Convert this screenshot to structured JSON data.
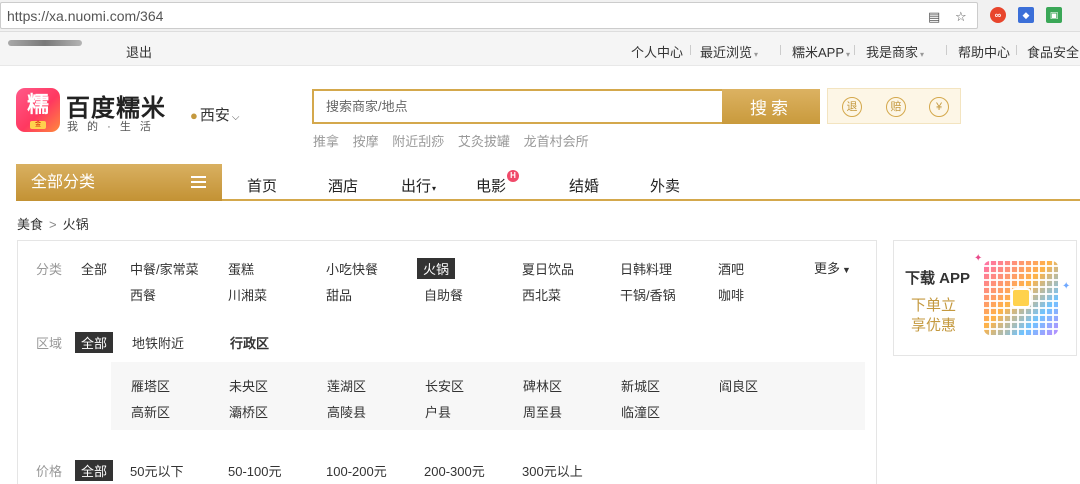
{
  "browser": {
    "url": "https://xa.nuomi.com/364",
    "icons": [
      "translate-icon",
      "star-icon",
      "extension-icons"
    ]
  },
  "top_bar": {
    "logout": "退出",
    "links": [
      {
        "label": "个人中心",
        "has_caret": false
      },
      {
        "label": "最近浏览",
        "has_caret": true
      },
      {
        "label": "糯米APP",
        "has_caret": true
      },
      {
        "label": "我是商家",
        "has_caret": true
      },
      {
        "label": "帮助中心",
        "has_caret": false
      },
      {
        "label": "食品安全",
        "has_caret": false
      }
    ]
  },
  "header": {
    "logo_char": "糯",
    "logo_sub": "金",
    "brand_name": "百度糯米",
    "slogan": "我 的 · 生 活",
    "city": "西安",
    "search": {
      "placeholder": "搜索商家/地点",
      "button": "搜索"
    },
    "hot_words": [
      "推拿",
      "按摩",
      "附近刮痧",
      "艾灸拔罐",
      "龙首村会所"
    ],
    "badges": [
      "退",
      "赔",
      "¥"
    ]
  },
  "nav": {
    "all_categories": "全部分类",
    "items": [
      {
        "label": "首页"
      },
      {
        "label": "酒店"
      },
      {
        "label": "出行",
        "caret": "▾"
      },
      {
        "label": "电影",
        "badge": "H"
      },
      {
        "label": "结婚"
      },
      {
        "label": "外卖"
      }
    ]
  },
  "breadcrumb": [
    "美食",
    "火锅"
  ],
  "filters": {
    "category": {
      "label": "分类",
      "all": "全部",
      "row1": [
        "中餐/家常菜",
        "蛋糕",
        "小吃快餐",
        "火锅",
        "夏日饮品",
        "日韩料理",
        "酒吧"
      ],
      "row2": [
        "西餐",
        "川湘菜",
        "甜品",
        "自助餐",
        "西北菜",
        "干锅/香锅",
        "咖啡"
      ],
      "selected": "火锅",
      "more": "更多"
    },
    "region": {
      "label": "区域",
      "all": "全部",
      "tabs": [
        "地铁附近",
        "行政区"
      ],
      "districts_row1": [
        "雁塔区",
        "未央区",
        "莲湖区",
        "长安区",
        "碑林区",
        "新城区",
        "阎良区"
      ],
      "districts_row2": [
        "高新区",
        "灞桥区",
        "高陵县",
        "户县",
        "周至县",
        "临潼区"
      ]
    },
    "price": {
      "label": "价格",
      "all": "全部",
      "options": [
        "50元以下",
        "50-100元",
        "100-200元",
        "200-300元",
        "300元以上"
      ]
    }
  },
  "promo": {
    "title": "下载 APP",
    "line1": "下单立",
    "line2": "享优惠"
  },
  "colors": {
    "gold": "#c99a3c",
    "selected_bg": "#333333",
    "hot_badge": "#f04a6a"
  }
}
